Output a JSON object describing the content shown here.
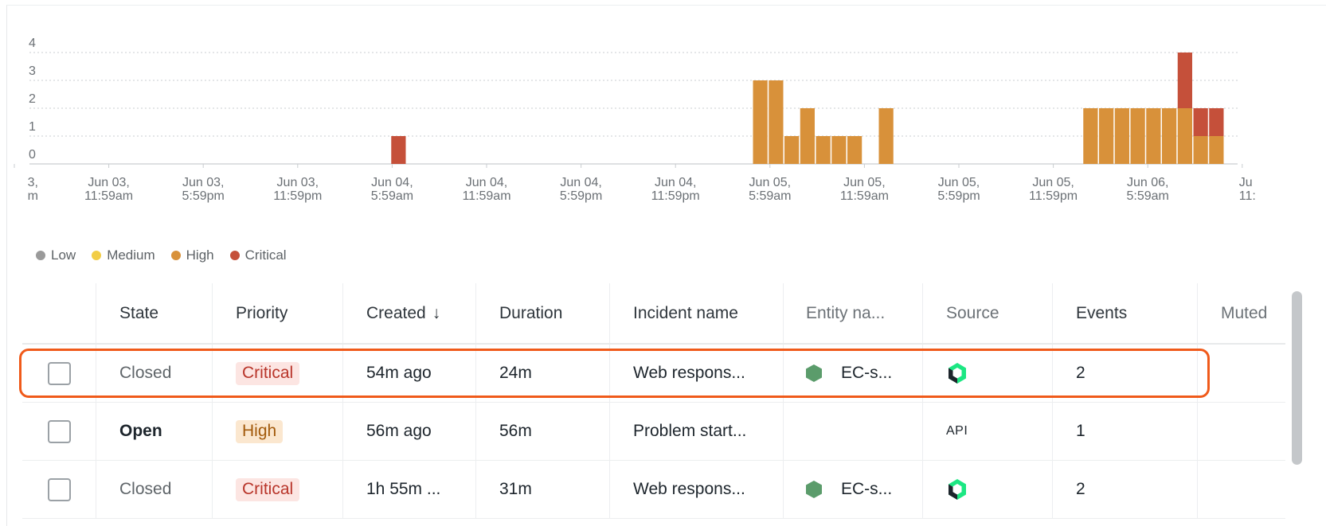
{
  "chart_data": {
    "type": "bar",
    "stacked": true,
    "y_ticks": [
      "0",
      "1",
      "2",
      "3",
      "4"
    ],
    "ylim": [
      0,
      4
    ],
    "x_tick_labels": [
      [
        "3,",
        "m"
      ],
      [
        "Jun 03,",
        "11:59am"
      ],
      [
        "Jun 03,",
        "5:59pm"
      ],
      [
        "Jun 03,",
        "11:59pm"
      ],
      [
        "Jun 04,",
        "5:59am"
      ],
      [
        "Jun 04,",
        "11:59am"
      ],
      [
        "Jun 04,",
        "5:59pm"
      ],
      [
        "Jun 04,",
        "11:59pm"
      ],
      [
        "Jun 05,",
        "5:59am"
      ],
      [
        "Jun 05,",
        "11:59am"
      ],
      [
        "Jun 05,",
        "5:59pm"
      ],
      [
        "Jun 05,",
        "11:59pm"
      ],
      [
        "Jun 06,",
        "5:59am"
      ],
      [
        "Ju",
        "11:"
      ]
    ],
    "bars": [
      {
        "bin": 23,
        "high": 0,
        "critical": 1
      },
      {
        "bin": 46,
        "high": 3,
        "critical": 0
      },
      {
        "bin": 47,
        "high": 3,
        "critical": 0
      },
      {
        "bin": 48,
        "high": 1,
        "critical": 0
      },
      {
        "bin": 49,
        "high": 2,
        "critical": 0
      },
      {
        "bin": 50,
        "high": 1,
        "critical": 0
      },
      {
        "bin": 51,
        "high": 1,
        "critical": 0
      },
      {
        "bin": 52,
        "high": 1,
        "critical": 0
      },
      {
        "bin": 54,
        "high": 2,
        "critical": 0
      },
      {
        "bin": 67,
        "high": 2,
        "critical": 0
      },
      {
        "bin": 68,
        "high": 2,
        "critical": 0
      },
      {
        "bin": 69,
        "high": 2,
        "critical": 0
      },
      {
        "bin": 70,
        "high": 2,
        "critical": 0
      },
      {
        "bin": 71,
        "high": 2,
        "critical": 0
      },
      {
        "bin": 72,
        "high": 2,
        "critical": 0
      },
      {
        "bin": 73,
        "high": 2,
        "critical": 2
      },
      {
        "bin": 74,
        "high": 1,
        "critical": 1
      },
      {
        "bin": 75,
        "high": 1,
        "critical": 1
      }
    ],
    "legend": [
      {
        "label": "Low",
        "color": "#9a9a9a"
      },
      {
        "label": "Medium",
        "color": "#f2cd46"
      },
      {
        "label": "High",
        "color": "#d8913a"
      },
      {
        "label": "Critical",
        "color": "#c5503a"
      }
    ]
  },
  "table": {
    "headers": {
      "state": "State",
      "priority": "Priority",
      "created": "Created",
      "sort_arrow": "↓",
      "duration": "Duration",
      "incident_name": "Incident name",
      "entity_name": "Entity na...",
      "source": "Source",
      "events": "Events",
      "muted": "Muted"
    },
    "rows": [
      {
        "state": "Closed",
        "state_style": "closed",
        "priority": "Critical",
        "created": "54m ago",
        "duration": "24m",
        "incident_name": "Web respons...",
        "entity": "EC-s...",
        "source_icon": "new-relic-icon",
        "source_text": "",
        "events": "2",
        "highlighted": true
      },
      {
        "state": "Open",
        "state_style": "open",
        "priority": "High",
        "created": "56m ago",
        "duration": "56m",
        "incident_name": "Problem start...",
        "entity": "",
        "source_icon": "",
        "source_text": "API",
        "events": "1",
        "highlighted": false
      },
      {
        "state": "Closed",
        "state_style": "closed",
        "priority": "Critical",
        "created": "1h 55m ...",
        "duration": "31m",
        "incident_name": "Web respons...",
        "entity": "EC-s...",
        "source_icon": "new-relic-icon",
        "source_text": "",
        "events": "2",
        "highlighted": false
      }
    ]
  }
}
